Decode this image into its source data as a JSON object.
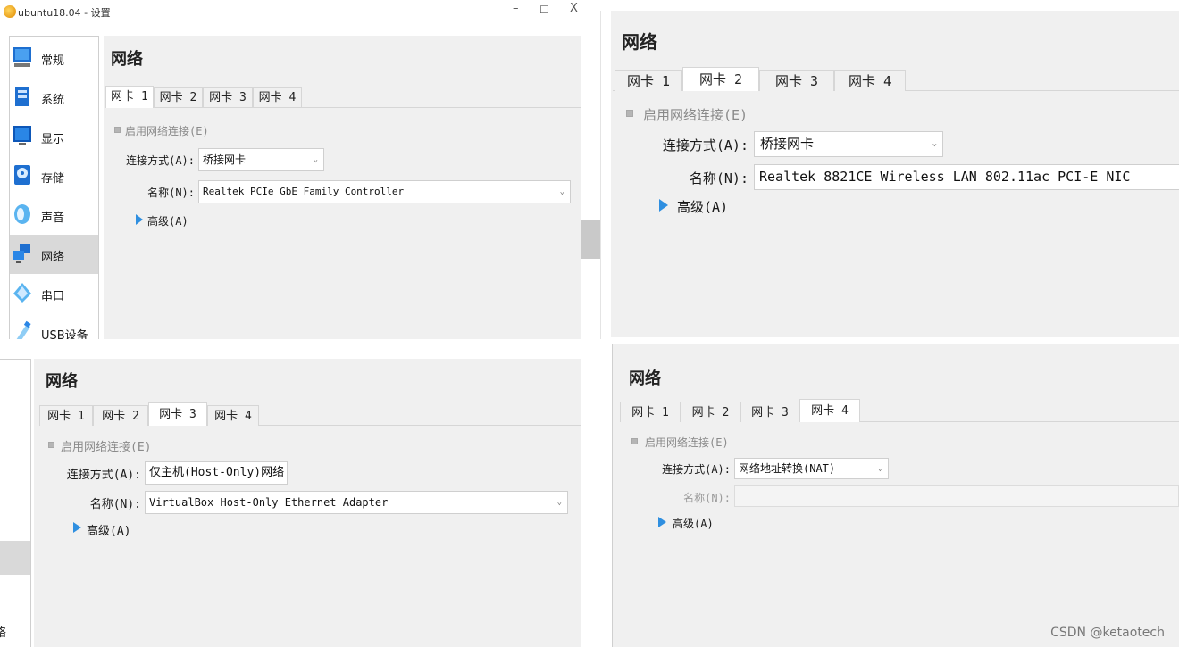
{
  "window": {
    "title": "ubuntu18.04 - 设置",
    "minimize_glyph": "–",
    "maximize_glyph": "☐",
    "close_glyph": "X"
  },
  "sidebar": {
    "items": [
      {
        "label": "常规",
        "icon": "general-icon"
      },
      {
        "label": "系统",
        "icon": "system-icon"
      },
      {
        "label": "显示",
        "icon": "display-icon"
      },
      {
        "label": "存储",
        "icon": "storage-icon"
      },
      {
        "label": "声音",
        "icon": "audio-icon"
      },
      {
        "label": "网络",
        "icon": "network-icon",
        "selected": true
      },
      {
        "label": "串口",
        "icon": "serial-port-icon"
      },
      {
        "label": "USB设备",
        "icon": "usb-icon"
      }
    ],
    "partial_label": "络"
  },
  "panels": [
    {
      "title": "网络",
      "tabs": [
        "网卡 1",
        "网卡 2",
        "网卡 3",
        "网卡 4"
      ],
      "active_tab": 0,
      "enable_label": "启用网络连接(E)",
      "attached_label": "连接方式(A):",
      "attached_value": "桥接网卡",
      "name_label": "名称(N):",
      "name_value": "Realtek PCIe GbE Family Controller",
      "advanced_label": "高级(A)"
    },
    {
      "title": "网络",
      "tabs": [
        "网卡 1",
        "网卡 2",
        "网卡 3",
        "网卡 4"
      ],
      "active_tab": 1,
      "enable_label": "启用网络连接(E)",
      "attached_label": "连接方式(A):",
      "attached_value": "桥接网卡",
      "name_label": "名称(N):",
      "name_value": "Realtek 8821CE Wireless LAN 802.11ac PCI-E NIC",
      "advanced_label": "高级(A)"
    },
    {
      "title": "网络",
      "tabs": [
        "网卡 1",
        "网卡 2",
        "网卡 3",
        "网卡 4"
      ],
      "active_tab": 2,
      "enable_label": "启用网络连接(E)",
      "attached_label": "连接方式(A):",
      "attached_value": "仅主机(Host-Only)网络",
      "name_label": "名称(N):",
      "name_value": "VirtualBox Host-Only Ethernet Adapter",
      "advanced_label": "高级(A)"
    },
    {
      "title": "网络",
      "tabs": [
        "网卡 1",
        "网卡 2",
        "网卡 3",
        "网卡 4"
      ],
      "active_tab": 3,
      "enable_label": "启用网络连接(E)",
      "attached_label": "连接方式(A):",
      "attached_value": "网络地址转换(NAT)",
      "name_label": "名称(N):",
      "name_value": "",
      "advanced_label": "高级(A)"
    }
  ],
  "watermark": "CSDN @ketaotech",
  "colors": {
    "accent_arrow": "#2f8fe0",
    "selected_bg": "#d9d9d9",
    "content_bg": "#f0f0f0"
  }
}
